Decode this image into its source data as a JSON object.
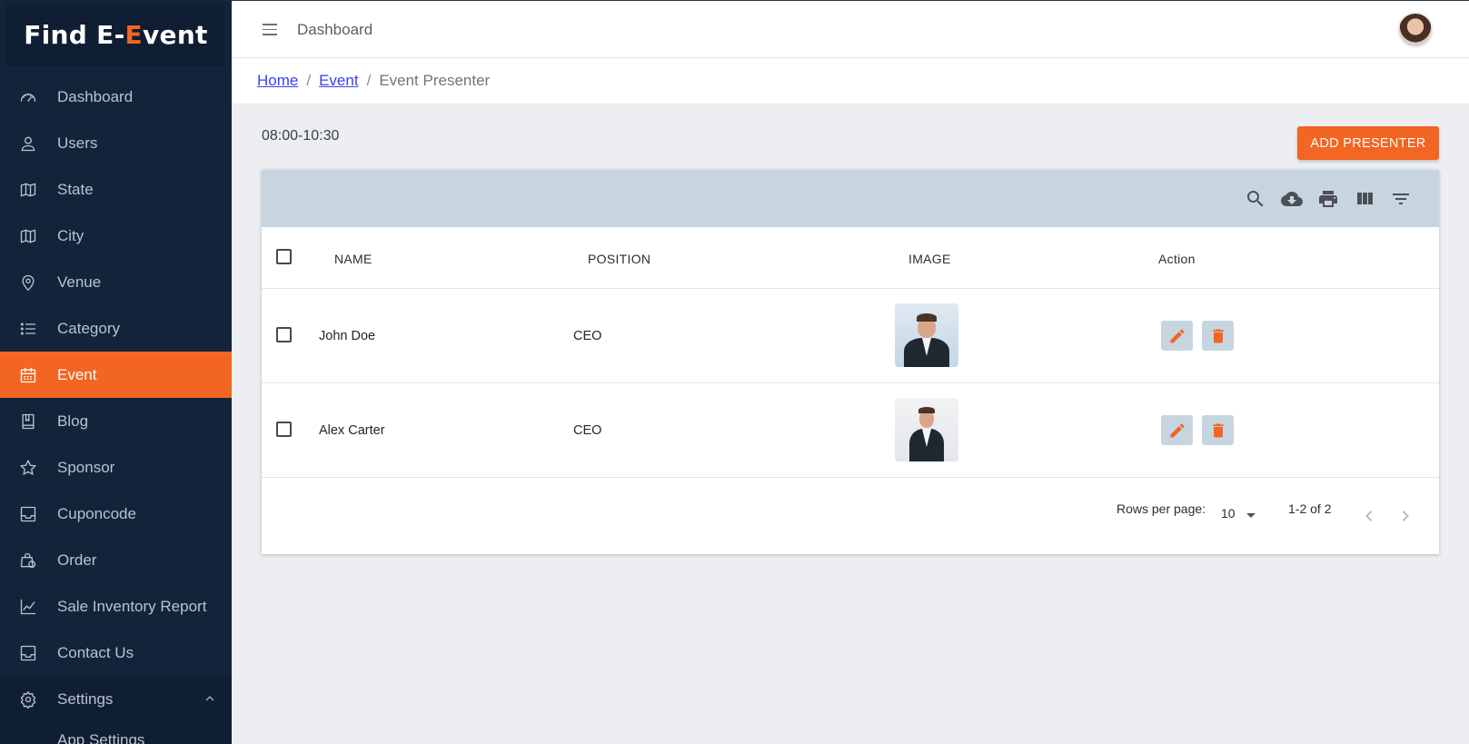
{
  "app": {
    "logo_part1": "Find E-",
    "logo_accent": "E",
    "logo_part2": "vent"
  },
  "topbar": {
    "title": "Dashboard"
  },
  "sidebar": {
    "items": [
      {
        "label": "Dashboard",
        "icon": "gauge-icon"
      },
      {
        "label": "Users",
        "icon": "user-icon"
      },
      {
        "label": "State",
        "icon": "map-icon"
      },
      {
        "label": "City",
        "icon": "map-icon"
      },
      {
        "label": "Venue",
        "icon": "location-pin-icon"
      },
      {
        "label": "Category",
        "icon": "list-icon"
      },
      {
        "label": "Event",
        "icon": "calendar-icon",
        "active": true
      },
      {
        "label": "Blog",
        "icon": "book-icon"
      },
      {
        "label": "Sponsor",
        "icon": "star-icon"
      },
      {
        "label": "Cuponcode",
        "icon": "inbox-icon"
      },
      {
        "label": "Order",
        "icon": "shopping-bag-icon"
      },
      {
        "label": "Sale Inventory Report",
        "icon": "line-chart-icon"
      },
      {
        "label": "Contact Us",
        "icon": "inbox-icon"
      },
      {
        "label": "Settings",
        "icon": "gear-icon",
        "expanded": true
      }
    ],
    "sub_item": "App Settings"
  },
  "breadcrumb": {
    "home": "Home",
    "event": "Event",
    "current": "Event Presenter",
    "separator": "/"
  },
  "page": {
    "time_range": "08:00-10:30",
    "add_button": "ADD PRESENTER"
  },
  "table": {
    "headers": {
      "name": "NAME",
      "position": "POSITION",
      "image": "IMAGE",
      "action": "Action"
    },
    "rows": [
      {
        "name": "John Doe",
        "position": "CEO"
      },
      {
        "name": "Alex Carter",
        "position": "CEO"
      }
    ],
    "toolbar_icons": [
      "search-icon",
      "cloud-download-icon",
      "print-icon",
      "view-column-icon",
      "filter-icon"
    ],
    "footer": {
      "rows_per_page_label": "Rows per page:",
      "rows_per_page_value": "10",
      "range": "1-2 of 2"
    }
  },
  "colors": {
    "accent": "#f26522",
    "sidebar_bg": "#13233a",
    "toolbar_bg": "#c7d5e0"
  }
}
